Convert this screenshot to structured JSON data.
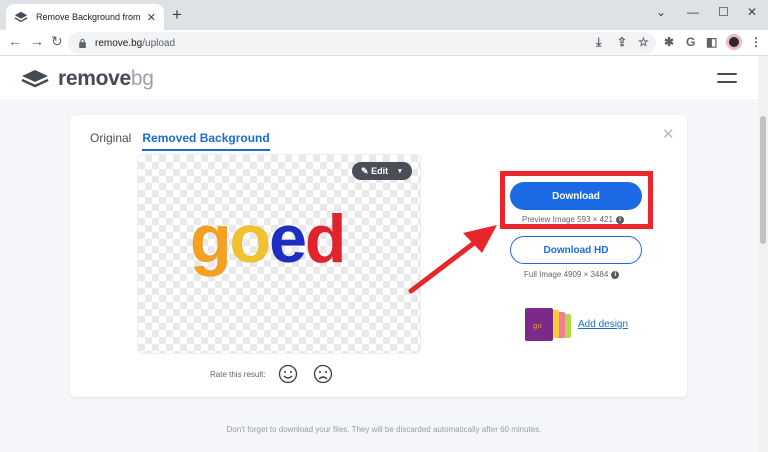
{
  "browser": {
    "tab_title": "Remove Background from Image",
    "new_tab": "+",
    "url_domain": "remove.bg",
    "url_path": "/upload",
    "ext_g": "G"
  },
  "site": {
    "logo_word_main": "remove",
    "logo_word_bg": "bg"
  },
  "card": {
    "tabs": [
      {
        "label": "Original"
      },
      {
        "label": "Removed Background"
      }
    ],
    "edit_label": "Edit",
    "image_text": "goed",
    "rate_label": "Rate this result:",
    "download_label": "Download",
    "preview_meta": "Preview Image 593 × 421",
    "download_hd_label": "Download HD",
    "full_meta": "Full Image 4909 × 3484",
    "add_design_label": "Add design"
  },
  "footer": {
    "note": "Don't forget to download your files. They will be discarded automatically after 60 minutes."
  },
  "colors": {
    "accent": "#1d6ae5",
    "highlight": "#e8262b"
  },
  "icons": [
    "back-icon",
    "forward-icon",
    "reload-icon",
    "lock-icon",
    "share-icon",
    "star-icon",
    "extensions-icon",
    "hamburger-icon",
    "close-icon",
    "pencil-icon",
    "smile-icon",
    "frown-icon",
    "info-icon"
  ]
}
